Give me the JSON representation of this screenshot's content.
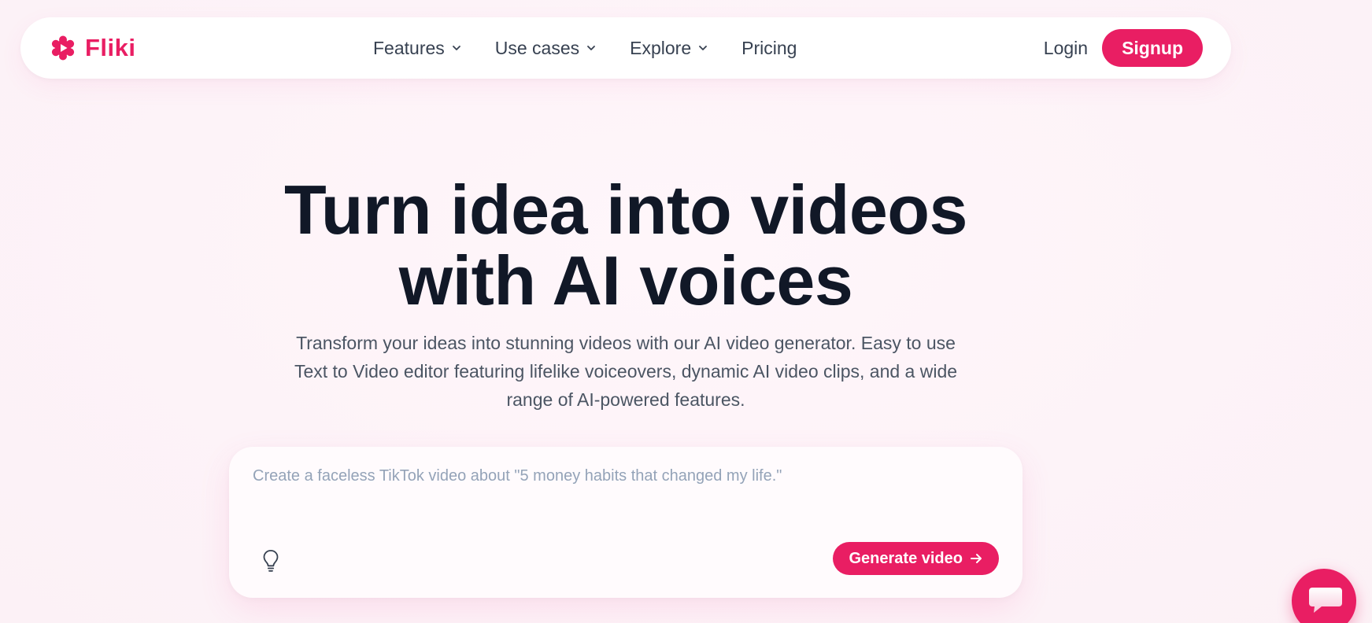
{
  "brand": {
    "name": "Fliki",
    "accent_color": "#e91e63",
    "logo_icon": "flower-play-icon"
  },
  "nav": {
    "items": [
      {
        "label": "Features",
        "has_dropdown": true
      },
      {
        "label": "Use cases",
        "has_dropdown": true
      },
      {
        "label": "Explore",
        "has_dropdown": true
      },
      {
        "label": "Pricing",
        "has_dropdown": false
      }
    ],
    "login_label": "Login",
    "signup_label": "Signup"
  },
  "hero": {
    "title_line1": "Turn idea into videos",
    "title_line2": "with AI voices",
    "subtitle": "Transform your ideas into stunning videos with our AI video generator. Easy to use Text to Video editor featuring lifelike voiceovers, dynamic AI video clips, and a wide range of AI-powered features."
  },
  "prompt": {
    "placeholder": "Create a faceless TikTok video about \"5 money habits that changed my life.\"",
    "value": "",
    "idea_icon": "lightbulb-icon",
    "generate_label": "Generate video",
    "generate_icon": "arrow-right-icon"
  },
  "chat": {
    "icon": "chat-bubble-icon"
  }
}
